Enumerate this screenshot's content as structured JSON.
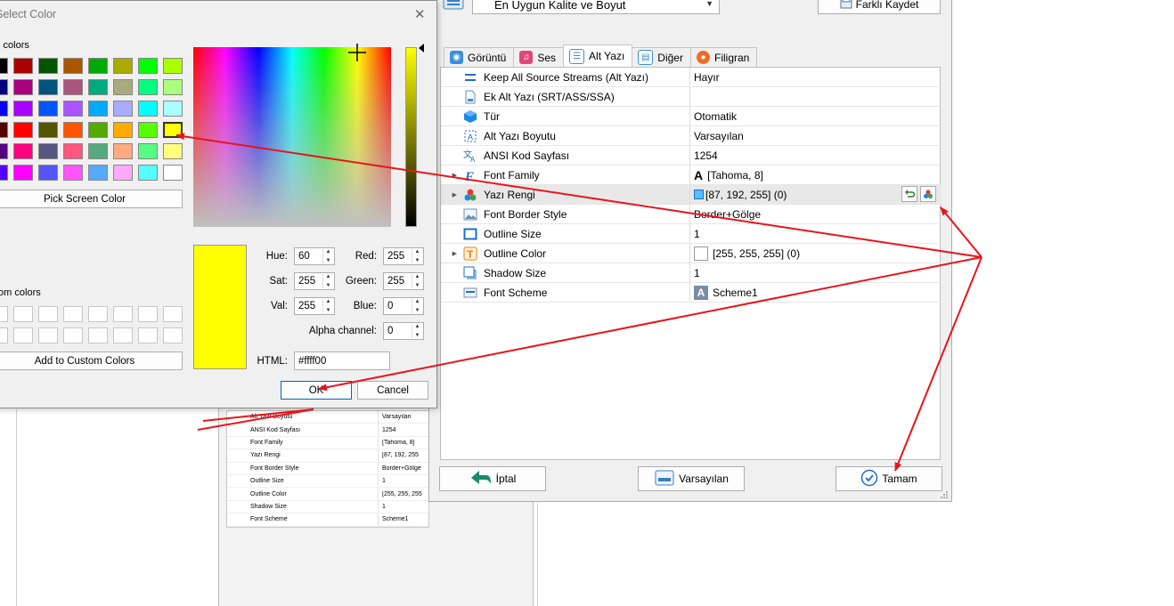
{
  "background": {
    "rows": [
      {
        "name": "Alt Yazı Boyutu",
        "value": "Varsayılan"
      },
      {
        "name": "ANSI Kod Sayfası",
        "value": "1254"
      },
      {
        "name": "Font Family",
        "value": "[Tahoma, 8]"
      },
      {
        "name": "Yazı Rengi",
        "value": "[87, 192, 255"
      },
      {
        "name": "Font Border Style",
        "value": "Border+Gölge"
      },
      {
        "name": "Outline Size",
        "value": "1"
      },
      {
        "name": "Outline Color",
        "value": "[255, 255, 255"
      },
      {
        "name": "Shadow Size",
        "value": "1"
      },
      {
        "name": "Font Scheme",
        "value": "Scheme1"
      }
    ]
  },
  "main": {
    "preset": "En Uygun Kalite ve Boyut",
    "save_as": "Farklı Kaydet",
    "tabs": [
      {
        "label": "Görüntü",
        "icon": "display-icon",
        "color": "#3a8fd8"
      },
      {
        "label": "Ses",
        "icon": "music-icon",
        "color": "#e0457b"
      },
      {
        "label": "Alt Yazı",
        "icon": "subtitle-icon",
        "color": "#3a8fd8"
      },
      {
        "label": "Diğer",
        "icon": "other-icon",
        "color": "#3a8fd8"
      },
      {
        "label": "Filigran",
        "icon": "watermark-icon",
        "color": "#f26b21"
      }
    ],
    "active_tab": "Alt Yazı",
    "properties": [
      {
        "name": "Keep All Source Streams (Alt Yazı)",
        "value": "Hayır",
        "icon": "equals-icon"
      },
      {
        "name": "Ek Alt Yazı (SRT/ASS/SSA)",
        "value": "",
        "icon": "file-icon"
      },
      {
        "name": "Tür",
        "value": "Otomatik",
        "icon": "cube-icon"
      },
      {
        "name": "Alt Yazı Boyutu",
        "value": "Varsayılan",
        "icon": "resize-icon"
      },
      {
        "name": "ANSI Kod Sayfası",
        "value": "1254",
        "icon": "translate-icon"
      },
      {
        "name": "Font Family",
        "value": "[Tahoma, 8]",
        "icon": "font-icon"
      },
      {
        "name": "Yazı Rengi",
        "value": "[87, 192, 255] (0)",
        "icon": "palette-icon"
      },
      {
        "name": "Font Border Style",
        "value": "Border+Gölge",
        "icon": "image-icon"
      },
      {
        "name": "Outline Size",
        "value": "1",
        "icon": "outline-icon"
      },
      {
        "name": "Outline Color",
        "value": "[255, 255, 255] (0)",
        "icon": "text-color-icon"
      },
      {
        "name": "Shadow Size",
        "value": "1",
        "icon": "shadow-icon"
      },
      {
        "name": "Font Scheme",
        "value": "Scheme1",
        "icon": "scheme-icon"
      }
    ],
    "buttons": {
      "cancel": "İptal",
      "defaults": "Varsayılan",
      "ok": "Tamam"
    }
  },
  "color_dialog": {
    "title": "Select Color",
    "basic_label": "c colors",
    "basic_colors": [
      "#000000",
      "#aa0000",
      "#005500",
      "#aa5500",
      "#00aa00",
      "#aaaa00",
      "#00ff00",
      "#aaff00",
      "#00007f",
      "#aa007f",
      "#00557f",
      "#aa557f",
      "#00aa7f",
      "#aaaa7f",
      "#00ff7f",
      "#aaff7f",
      "#0000ff",
      "#aa00ff",
      "#0055ff",
      "#aa55ff",
      "#00aaff",
      "#aaaaff",
      "#00ffff",
      "#aaffff",
      "#550000",
      "#ff0000",
      "#555500",
      "#ff5500",
      "#55aa00",
      "#ffaa00",
      "#55ff00",
      "#ffff00",
      "#55007f",
      "#ff007f",
      "#55557f",
      "#ff557f",
      "#55aa7f",
      "#ffaa7f",
      "#55ff7f",
      "#ffff7f",
      "#5500ff",
      "#ff00ff",
      "#5555ff",
      "#ff55ff",
      "#55aaff",
      "#ffaaff",
      "#55ffff",
      "#ffffff"
    ],
    "pick_screen": "Pick Screen Color",
    "custom_label": "tom colors",
    "add_custom": "Add to Custom Colors",
    "hue_label": "Hue:",
    "hue": "60",
    "sat_label": "Sat:",
    "sat": "255",
    "val_label": "Val:",
    "val": "255",
    "red_label": "Red:",
    "red": "255",
    "green_label": "Green:",
    "green": "255",
    "blue_label": "Blue:",
    "blue": "0",
    "alpha_label": "Alpha channel:",
    "alpha": "0",
    "html_label": "HTML:",
    "html": "#ffff00",
    "ok": "OK",
    "cancel": "Cancel",
    "preview_color": "#ffff00"
  },
  "annotation_color": "#e8141a"
}
